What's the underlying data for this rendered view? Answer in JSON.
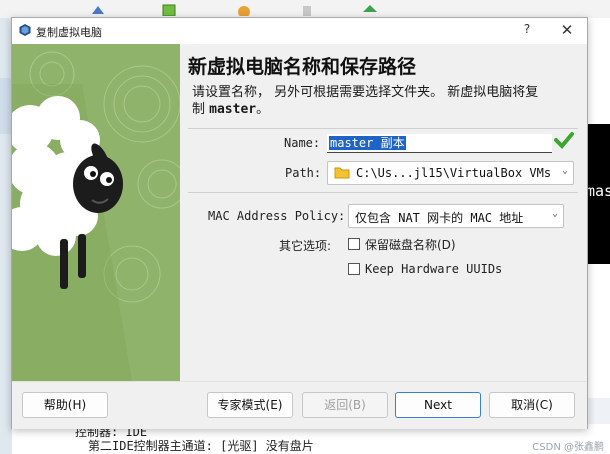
{
  "background": {
    "preview_text": "mas",
    "detail_line1": "控制器: IDE",
    "detail_line2": "第二IDE控制器主通道: [光驱] 没有盘片",
    "watermark": "CSDN @张鑫鹏"
  },
  "dialog": {
    "title": "复制虚拟电脑",
    "help_glyph": "?",
    "close_glyph": "✕",
    "heading": "新虚拟电脑名称和保存路径",
    "description_line1": "请设置名称， 另外可根据需要选择文件夹。 新虚拟电脑将复",
    "description_line2_prefix": "制 ",
    "description_vm_name": "master",
    "description_line2_suffix": "。",
    "name_label": "Name:",
    "name_value": "master 副本",
    "path_label": "Path:",
    "path_value": "C:\\Us...jl15\\VirtualBox VMs",
    "mac_label": "MAC Address Policy:",
    "mac_value": "仅包含 NAT 网卡的 MAC 地址",
    "other_options_label": "其它选项:",
    "keep_disk_names_label": "保留磁盘名称(D)",
    "keep_hw_uuids_label": "Keep Hardware UUIDs",
    "keep_disk_names_checked": false,
    "keep_hw_uuids_checked": false
  },
  "buttons": {
    "help": "帮助(H)",
    "expert": "专家模式(E)",
    "back": "返回(B)",
    "next": "Next",
    "cancel": "取消(C)"
  },
  "colors": {
    "art_green": "#8fb36a",
    "selection_blue": "#1e64c8",
    "valid_check": "#3aa82f"
  }
}
